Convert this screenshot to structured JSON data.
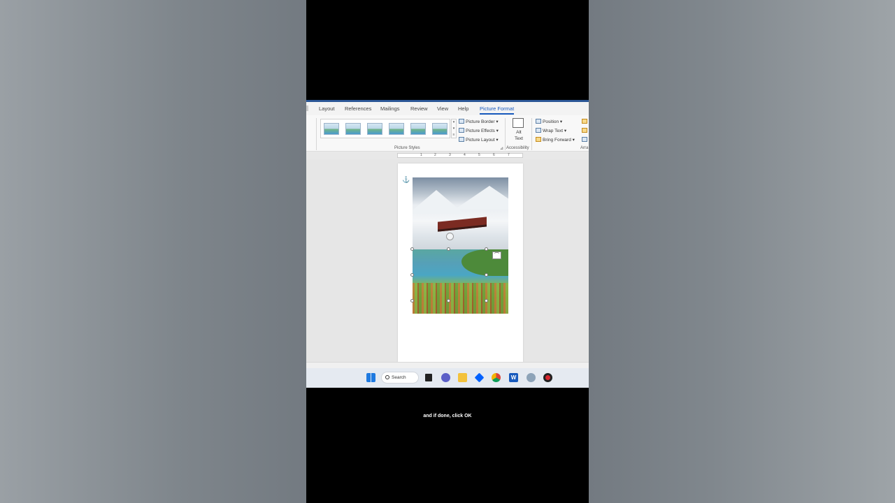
{
  "ribbon": {
    "tabs": [
      {
        "label": "Layout"
      },
      {
        "label": "References"
      },
      {
        "label": "Mailings"
      },
      {
        "label": "Review"
      },
      {
        "label": "View"
      },
      {
        "label": "Help"
      },
      {
        "label": "Picture Format",
        "active": true
      }
    ],
    "picture_styles": {
      "border_label": "Picture Border",
      "effects_label": "Picture Effects",
      "layout_label": "Picture Layout",
      "group_label": "Picture Styles"
    },
    "accessibility": {
      "alt_text_line1": "Alt",
      "alt_text_line2": "Text",
      "group_label": "Accessibility"
    },
    "arrange": {
      "position_label": "Position",
      "wrap_text_label": "Wrap Text",
      "bring_forward_label": "Bring Forward",
      "group_label": "Arra"
    }
  },
  "ruler": {
    "numbers": [
      "1",
      "2",
      "3",
      "4",
      "5",
      "6",
      "7"
    ]
  },
  "document": {
    "images": [
      {
        "name": "snowy-train-image"
      },
      {
        "name": "lake-village-image"
      }
    ]
  },
  "taskbar": {
    "search_label": "Search",
    "icons": [
      "windows-start-icon",
      "search-icon",
      "task-view-icon",
      "teams-chat-icon",
      "file-explorer-icon",
      "dropbox-icon",
      "chrome-icon",
      "word-icon",
      "settings-icon",
      "record-icon"
    ]
  },
  "caption": {
    "text": "and if done, click OK"
  },
  "colors": {
    "accent": "#185abd",
    "ribbon_bg": "#f8f8f8",
    "taskbar_bg": "#e5eaf1"
  }
}
